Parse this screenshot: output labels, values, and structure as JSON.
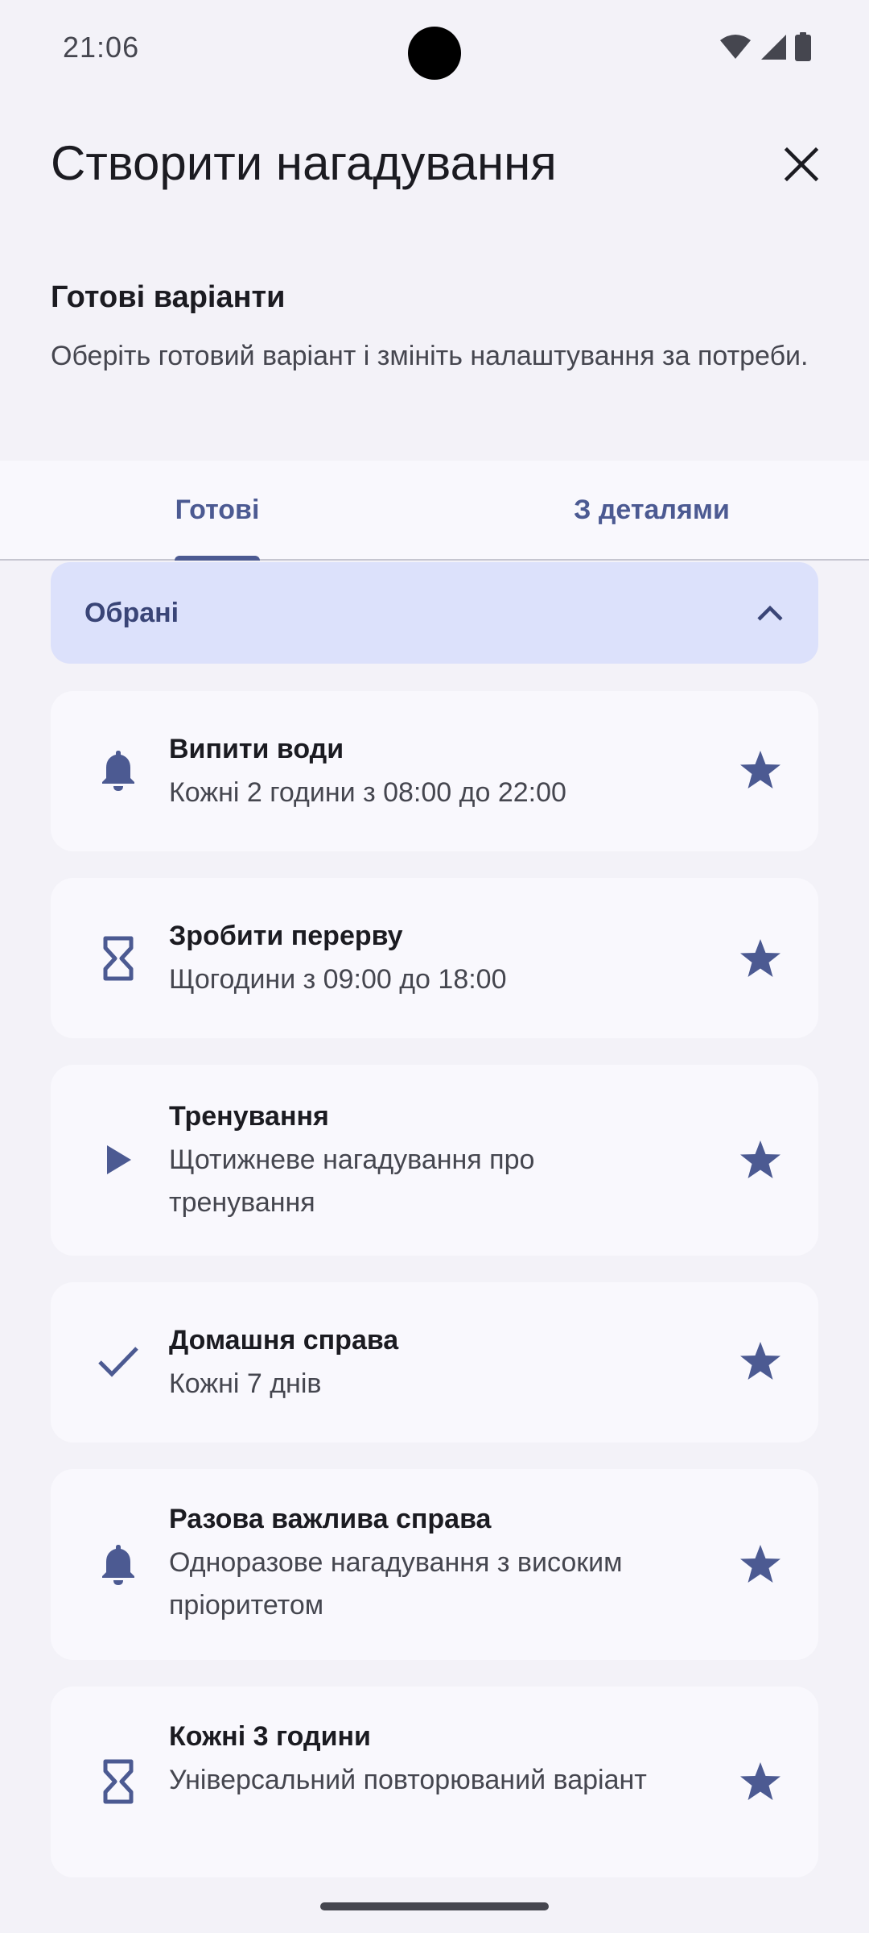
{
  "status_bar": {
    "time": "21:06"
  },
  "header": {
    "title": "Створити нагадування"
  },
  "section": {
    "title": "Готові варіанти",
    "description": "Оберіть готовий варіант і змініть налаштування за потреби."
  },
  "tabs": [
    {
      "label": "Готові",
      "active": true
    },
    {
      "label": "З деталями",
      "active": false
    }
  ],
  "group": {
    "label": "Обрані",
    "expanded": true
  },
  "items": [
    {
      "icon": "bell-icon",
      "title": "Випити води",
      "subtitle": "Кожні 2 години з 08:00 до 22:00",
      "favorite": true
    },
    {
      "icon": "hourglass-icon",
      "title": "Зробити перерву",
      "subtitle": "Щогодини з 09:00 до 18:00",
      "favorite": true
    },
    {
      "icon": "play-icon",
      "title": "Тренування",
      "subtitle": "Щотижневе нагадування про тренування",
      "favorite": true
    },
    {
      "icon": "check-icon",
      "title": "Домашня справа",
      "subtitle": "Кожні 7 днів",
      "favorite": true
    },
    {
      "icon": "bell-icon",
      "title": "Разова важлива справа",
      "subtitle": "Одноразове нагадування з високим пріоритетом",
      "favorite": true
    },
    {
      "icon": "hourglass-icon",
      "title": "Кожні 3 години",
      "subtitle": "Універсальний повторюваний варіант",
      "favorite": true
    }
  ],
  "colors": {
    "accent": "#4c5a92",
    "background": "#f3f2f8",
    "card": "#f9f8fd",
    "group_header": "#dce1fb"
  }
}
